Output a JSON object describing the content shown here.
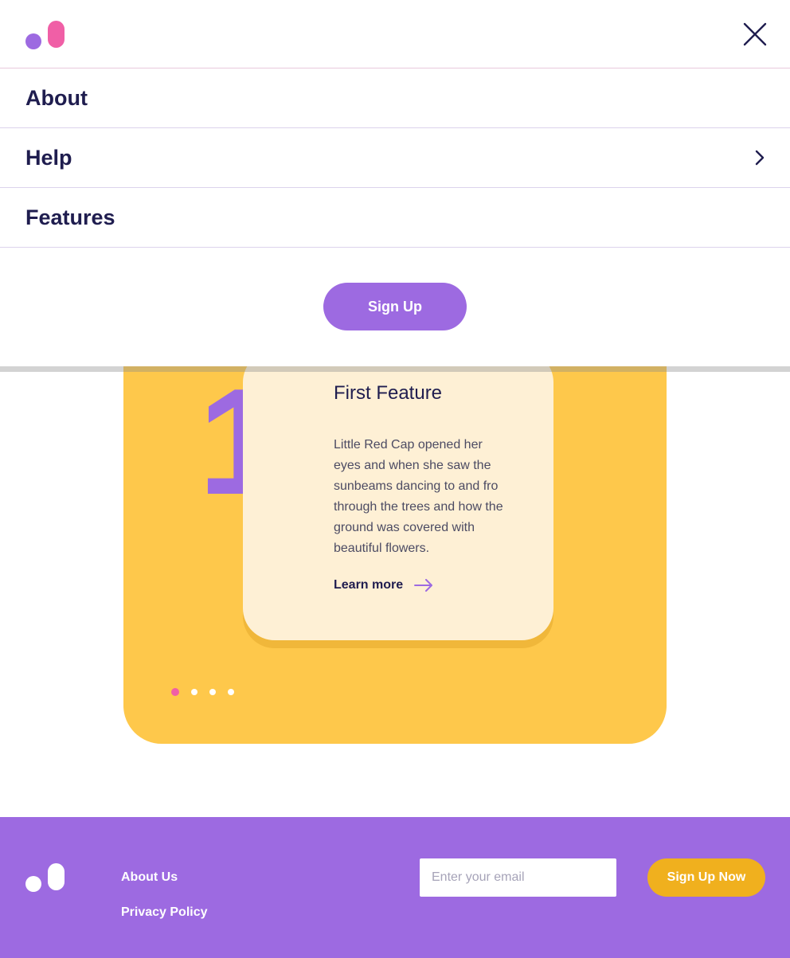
{
  "menu": {
    "items": [
      {
        "label": "About",
        "has_submenu": false
      },
      {
        "label": "Help",
        "has_submenu": true
      },
      {
        "label": "Features",
        "has_submenu": false
      }
    ],
    "signup_label": "Sign Up",
    "close_icon": "close-icon",
    "logo_icon": "brand-logo-icon"
  },
  "feature": {
    "number": "1",
    "title": "First Feature",
    "text": "Little Red Cap opened her eyes and when she saw the sunbeams dancing to and fro through the trees and how the ground was covered with beautiful flowers.",
    "learn_more_label": "Learn more",
    "learn_more_icon": "arrow-right-icon",
    "slides_total": 4,
    "active_slide": 1
  },
  "footer": {
    "links": [
      {
        "label": "About Us"
      },
      {
        "label": "Privacy Policy"
      }
    ],
    "email_placeholder": "Enter your email",
    "email_value": "",
    "signup_label": "Sign Up Now"
  },
  "colors": {
    "brand_purple": "#9d6ae1",
    "brand_pink": "#f05fa6",
    "panel_yellow": "#fec84b",
    "card_cream": "#fef0d5",
    "footer_button": "#f0b01e",
    "text_dark": "#1f1d4f"
  }
}
